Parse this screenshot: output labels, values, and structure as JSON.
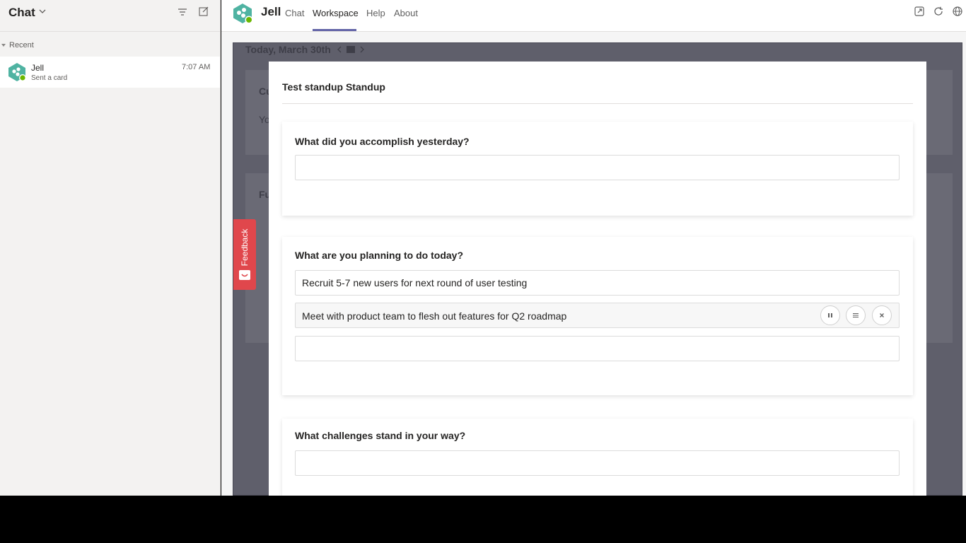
{
  "sidebar": {
    "title": "Chat",
    "section": "Recent",
    "items": [
      {
        "name": "Jell",
        "preview": "Sent a card",
        "time": "7:07 AM"
      }
    ]
  },
  "app": {
    "name": "Jell",
    "tabs": [
      {
        "label": "Chat"
      },
      {
        "label": "Workspace"
      },
      {
        "label": "Help"
      },
      {
        "label": "About"
      }
    ],
    "active_tab": "Workspace"
  },
  "background": {
    "date": "Today, March 30th",
    "card1_heading": "Cu",
    "card1_text": "Yo",
    "card2_heading": "Fu"
  },
  "feedback": {
    "label": "Feedback"
  },
  "modal": {
    "title": "Test standup Standup",
    "questions": [
      {
        "label": "What did you accomplish yesterday?",
        "answers": [
          ""
        ]
      },
      {
        "label": "What are you planning to do today?",
        "answers": [
          "Recruit 5-7 new users for next round of user testing",
          "Meet with product team to flesh out features for Q2 roadmap",
          ""
        ]
      },
      {
        "label": "What challenges stand in your way?",
        "answers": [
          ""
        ]
      }
    ]
  },
  "colors": {
    "accent": "#6264a7",
    "feedback": "#e0474c",
    "logo": "#4fb3a2",
    "presence": "#6bb700"
  }
}
